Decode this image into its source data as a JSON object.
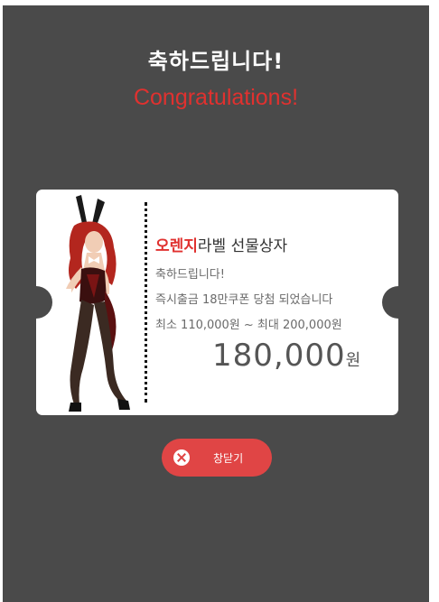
{
  "modal": {
    "title": "축하드립니다!",
    "subtitle": "Congratulations!"
  },
  "ticket": {
    "prize_accent": "오렌지",
    "prize_rest": "라벨 선물상자",
    "line1": "축하드립니다!",
    "line2": "즉시출금 18만쿠폰 당첨 되었습니다",
    "line3": "최소 110,000원 ~ 최대 200,000원",
    "amount": "180,000",
    "amount_unit": "원"
  },
  "close_button": {
    "label": "창닫기"
  },
  "colors": {
    "accent": "#e0312f",
    "button": "#e04545",
    "backdrop": "#4a4a4a"
  },
  "icons": {
    "close": "close-icon",
    "figure": "character-illustration"
  }
}
